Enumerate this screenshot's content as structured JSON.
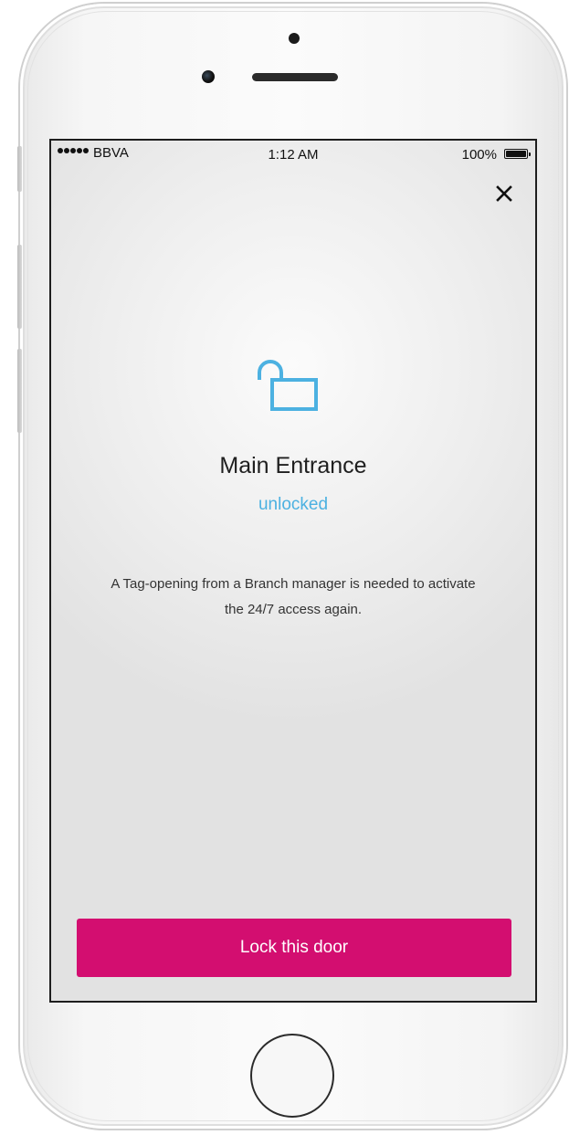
{
  "status_bar": {
    "carrier": "BBVA",
    "time": "1:12 AM",
    "battery": "100%",
    "signal_bars": 5
  },
  "header": {
    "close_icon": "close-icon"
  },
  "door": {
    "icon": "unlocked-padlock-icon",
    "name": "Main Entrance",
    "status": "unlocked",
    "message": "A Tag-opening from a Branch manager is needed to activate the 24/7 access again."
  },
  "actions": {
    "lock_label": "Lock this door"
  },
  "colors": {
    "accent_magenta": "#d30e70",
    "status_blue": "#4cb1e1"
  }
}
